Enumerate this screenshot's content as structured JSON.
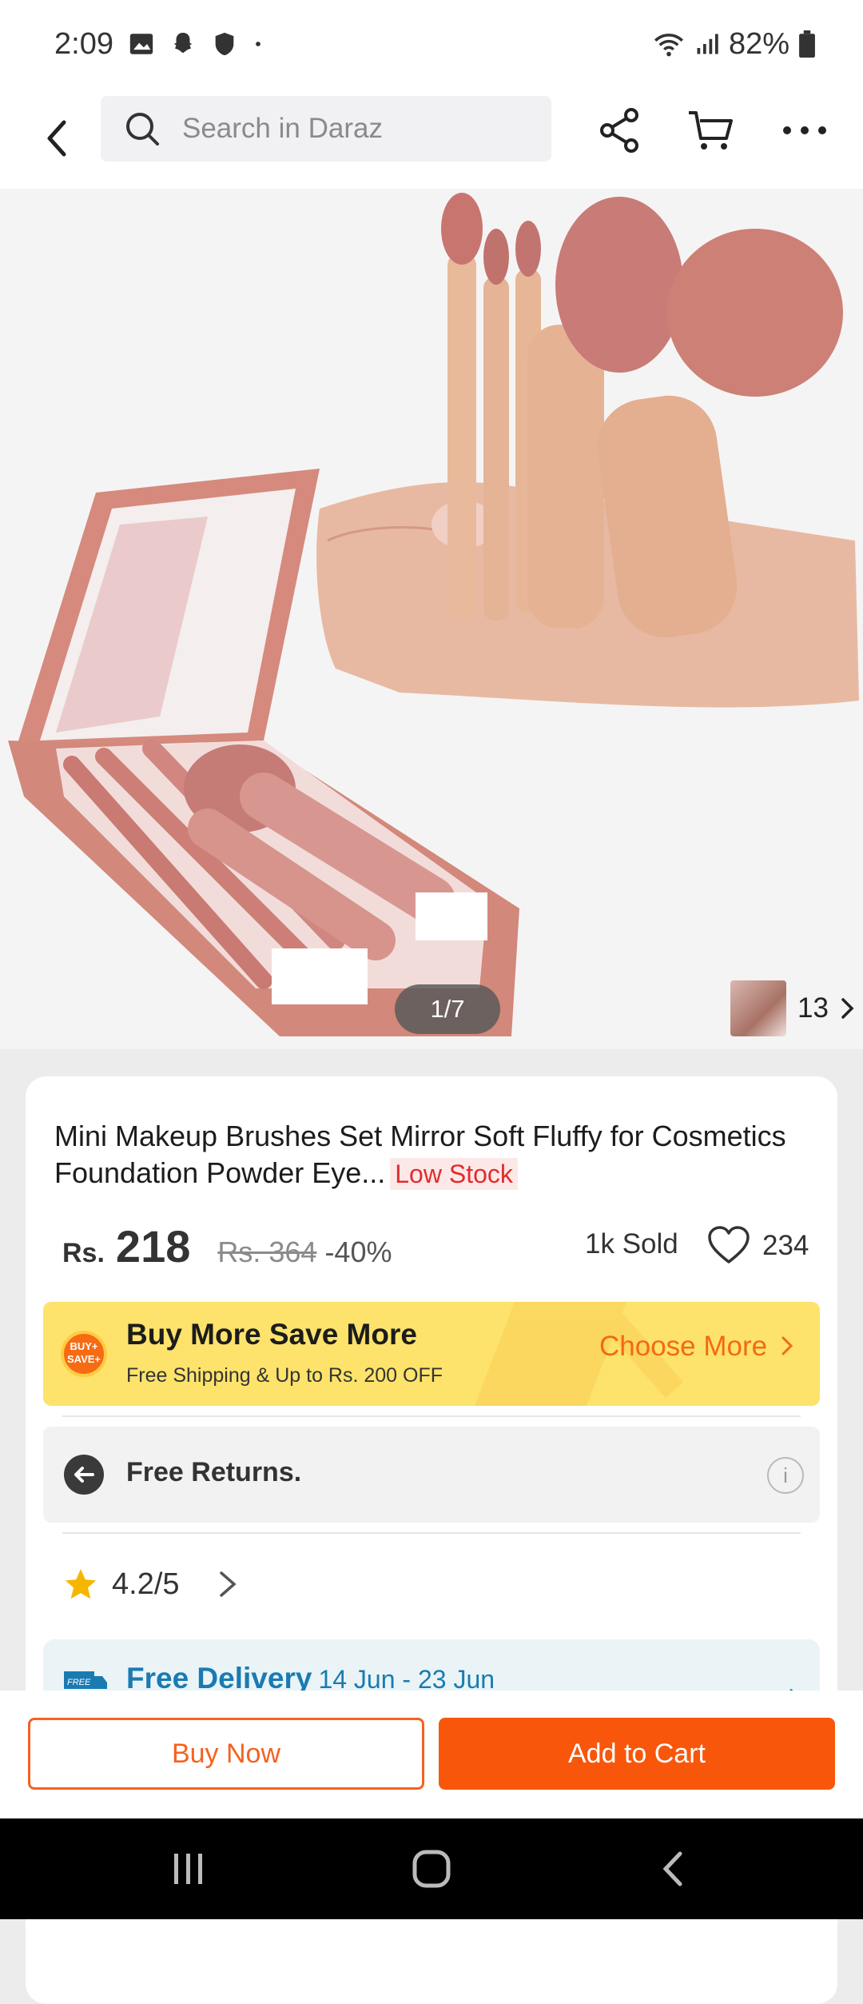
{
  "status_bar": {
    "time": "2:09",
    "battery": "82%"
  },
  "header": {
    "search_placeholder": "Search in Daraz",
    "icons": [
      "back-arrow-icon",
      "search-icon",
      "share-icon",
      "cart-icon",
      "more-icon"
    ]
  },
  "gallery": {
    "page_indicator": "1/7",
    "media_count": "13"
  },
  "product": {
    "title": "Mini Makeup Brushes Set Mirror Soft Fluffy for Cosmetics Foundation Powder Eye...",
    "stock_badge": "Low Stock",
    "currency": "Rs.",
    "price": "218",
    "old_price": "Rs. 364",
    "discount": "-40%",
    "sold": "1k Sold",
    "wishlist_count": "234"
  },
  "promo": {
    "badge": "BUY+ SAVE+",
    "title": "Buy More Save More",
    "subtitle": "Free Shipping & Up to Rs. 200 OFF",
    "cta": "Choose More"
  },
  "returns": {
    "label": "Free Returns.",
    "info": "i"
  },
  "rating": {
    "value": "4.2/5"
  },
  "delivery": {
    "label": "Free Delivery",
    "dates": "14 Jun - 23 Jun",
    "badge": "FREE"
  },
  "actions": {
    "buy_now": "Buy Now",
    "add_to_cart": "Add to Cart"
  },
  "colors": {
    "accent": "#f8570b",
    "promo_bg": "#fde36b",
    "low_stock": "#e02d2d",
    "delivery": "#1a7bb2"
  }
}
